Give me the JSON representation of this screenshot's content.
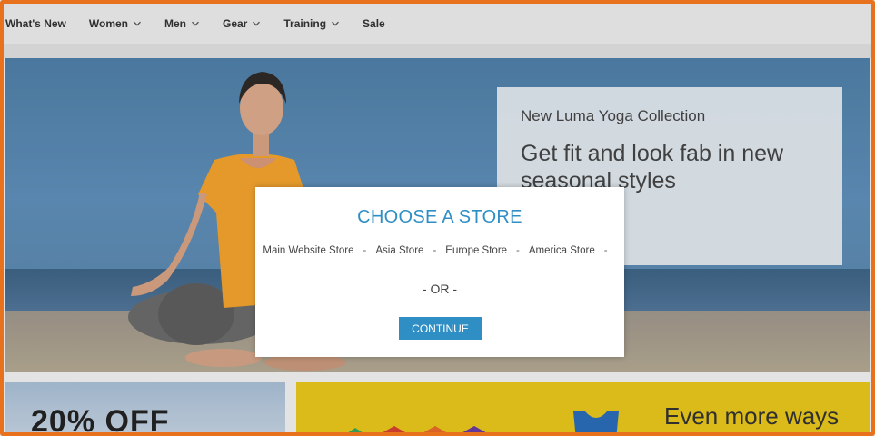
{
  "nav": {
    "items": [
      {
        "label": "What's New",
        "has_chevron": false
      },
      {
        "label": "Women",
        "has_chevron": true
      },
      {
        "label": "Men",
        "has_chevron": true
      },
      {
        "label": "Gear",
        "has_chevron": true
      },
      {
        "label": "Training",
        "has_chevron": true
      },
      {
        "label": "Sale",
        "has_chevron": false
      }
    ]
  },
  "hero": {
    "subtitle": "New Luma Yoga Collection",
    "title": "Get fit and look fab in new seasonal styles"
  },
  "promos": {
    "left_text": "20% OFF",
    "right_text": "Even more ways"
  },
  "modal": {
    "title": "CHOOSE A STORE",
    "stores": [
      "Main Website Store",
      "Asia Store",
      "Europe Store",
      "America Store"
    ],
    "or_text": "- OR -",
    "continue_label": "CONTINUE"
  },
  "colors": {
    "accent": "#2f8fc5",
    "frame": "#e8711d",
    "promo_yellow": "#e9c71b"
  }
}
